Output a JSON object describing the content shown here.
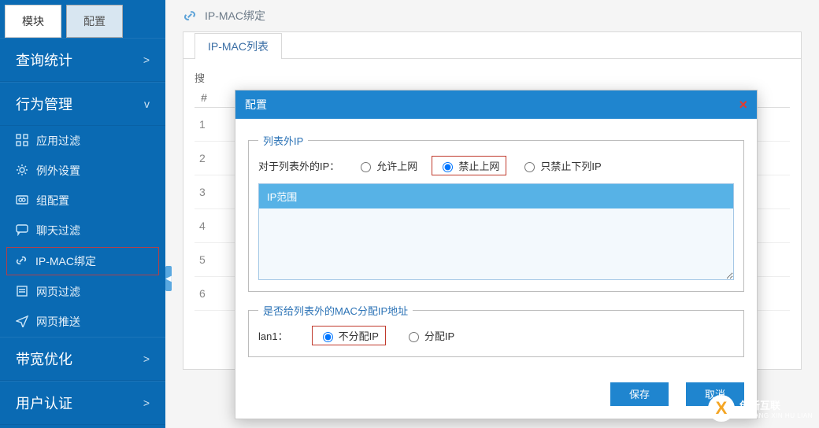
{
  "sidebar": {
    "tabs": {
      "module": "模块",
      "config": "配置"
    },
    "groups": {
      "stats": {
        "label": "查询统计",
        "chevron": ">"
      },
      "behavior": {
        "label": "行为管理",
        "chevron": "v"
      },
      "bandwidth": {
        "label": "带宽优化",
        "chevron": ">"
      },
      "userauth": {
        "label": "用户认证",
        "chevron": ">"
      }
    },
    "behavior_items": {
      "app_filter": "应用过滤",
      "exception": "例外设置",
      "group_config": "组配置",
      "chat_filter": "聊天过滤",
      "ipmac_bind": "IP-MAC绑定",
      "web_filter": "网页过滤",
      "web_push": "网页推送"
    }
  },
  "crumb": {
    "title": "IP-MAC绑定"
  },
  "panel": {
    "tab_label": "IP-MAC列表",
    "search_prefix": "搜",
    "col_hash": "#",
    "rows": [
      "1",
      "2",
      "3",
      "4",
      "5",
      "6"
    ]
  },
  "dialog": {
    "title": "配置",
    "close": "×",
    "fs1": {
      "legend": "列表外IP",
      "prompt": "对于列表外的IP：",
      "opt_allow": "允许上网",
      "opt_block": "禁止上网",
      "opt_block_list": "只禁止下列IP",
      "ip_range_header": "IP范围"
    },
    "fs2": {
      "legend": "是否给列表外的MAC分配IP地址",
      "lan_label": "lan1：",
      "opt_no_assign": "不分配IP",
      "opt_assign": "分配IP"
    },
    "btn_save": "保存",
    "btn_cancel": "取消"
  },
  "brand": {
    "mark": "X",
    "line1": "创新互联",
    "line2": "CHUANG XIN HU LIAN"
  }
}
